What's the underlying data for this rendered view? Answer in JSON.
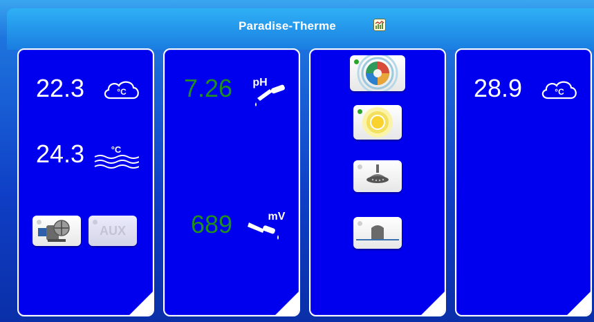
{
  "header": {
    "title": "Paradise-Therme"
  },
  "panel1": {
    "temp_air_value": "22.3",
    "temp_air_unit": "°C",
    "temp_water_value": "24.3",
    "temp_water_unit": "°C",
    "aux_label": "AUX"
  },
  "panel2": {
    "ph_value": "7.26",
    "ph_unit": "pH",
    "mv_value": "689",
    "mv_unit": "mV"
  },
  "panel4": {
    "temp_value": "28.9",
    "temp_unit": "°C"
  },
  "colors": {
    "panel_bg": "#0000ee",
    "value_green": "#1f8f1f",
    "led_green": "#2aa52a",
    "led_off": "#cfcfcf"
  }
}
